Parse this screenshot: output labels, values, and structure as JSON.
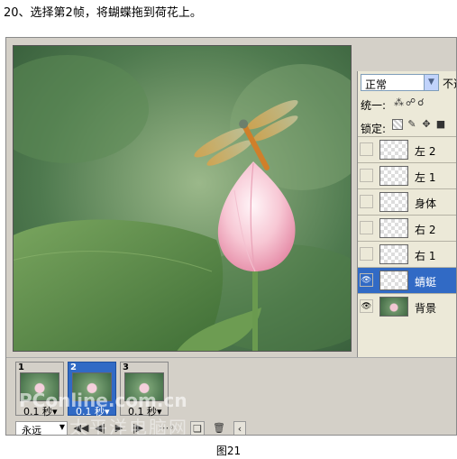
{
  "instruction": "20、选择第2帧，将蝴蝶拖到荷花上。",
  "caption": "图21",
  "layers_panel": {
    "blend_mode": "正常",
    "opacity_label": "不透",
    "unify_label": "统一:",
    "lock_label": "锁定:",
    "layers": [
      {
        "name": "左 2",
        "visible": false,
        "selected": false
      },
      {
        "name": "左 1",
        "visible": false,
        "selected": false
      },
      {
        "name": "身体",
        "visible": false,
        "selected": false
      },
      {
        "name": "右 2",
        "visible": false,
        "selected": false
      },
      {
        "name": "右 1",
        "visible": false,
        "selected": false
      },
      {
        "name": "蜻蜓",
        "visible": true,
        "selected": true
      },
      {
        "name": "背景",
        "visible": true,
        "selected": false
      }
    ],
    "footer_icons": [
      "link-icon",
      "fx-icon",
      "mask-icon",
      "adjustment-icon"
    ]
  },
  "animation": {
    "frames": [
      {
        "number": "1",
        "delay": "0.1 秒▾",
        "selected": false
      },
      {
        "number": "2",
        "delay": "0.1 秒▾",
        "selected": true
      },
      {
        "number": "3",
        "delay": "0.1 秒▾",
        "selected": false
      }
    ],
    "loop": "永远",
    "watermark": "PConline.com.cn",
    "watermark_cn": "太平洋电脑网"
  },
  "colors": {
    "selection": "#316ac5",
    "panel": "#ece9d8",
    "lotus_pink": "#f2b5c6",
    "leaf_green": "#5e8f4e"
  }
}
